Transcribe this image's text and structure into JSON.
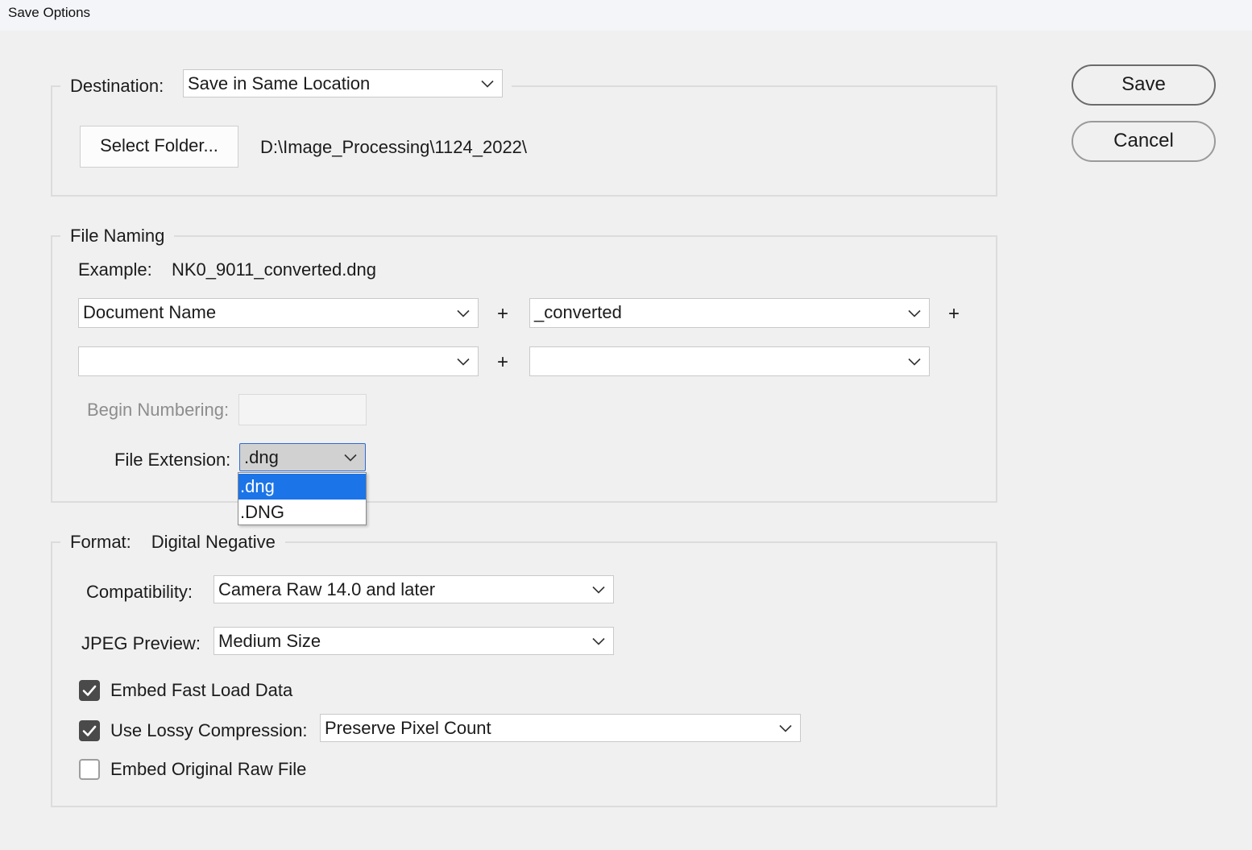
{
  "window": {
    "title": "Save Options"
  },
  "destination": {
    "label": "Destination:",
    "selected": "Save in Same Location",
    "select_folder_label": "Select Folder...",
    "path": "D:\\Image_Processing\\1124_2022\\"
  },
  "file_naming": {
    "title": "File Naming",
    "example_label": "Example:",
    "example_value": "NK0_9011_converted.dng",
    "fields": [
      {
        "value": "Document Name"
      },
      {
        "value": "_converted"
      },
      {
        "value": ""
      },
      {
        "value": ""
      }
    ],
    "plus": "+",
    "begin_numbering_label": "Begin Numbering:",
    "begin_numbering_value": "",
    "file_extension_label": "File Extension:",
    "file_extension_value": ".dng",
    "file_extension_options": [
      ".dng",
      ".DNG"
    ],
    "file_extension_highlighted": ".dng"
  },
  "format": {
    "label": "Format:",
    "value": "Digital Negative",
    "compatibility_label": "Compatibility:",
    "compatibility_value": "Camera Raw 14.0 and later",
    "jpeg_preview_label": "JPEG Preview:",
    "jpeg_preview_value": "Medium Size",
    "embed_fast_load_label": "Embed Fast Load Data",
    "embed_fast_load_checked": true,
    "lossy_label": "Use Lossy Compression:",
    "lossy_checked": true,
    "lossy_value": "Preserve Pixel Count",
    "embed_raw_label": "Embed Original Raw File",
    "embed_raw_checked": false
  },
  "actions": {
    "save_label": "Save",
    "cancel_label": "Cancel"
  },
  "icons": {
    "dropdown": "chevron-down-icon",
    "checkbox": "checkmark-icon"
  },
  "colors": {
    "background": "#f0f0f0",
    "highlight": "#1b74e8",
    "focus_border": "#2e6bd6",
    "checkbox_fill": "#4a4a4a"
  }
}
